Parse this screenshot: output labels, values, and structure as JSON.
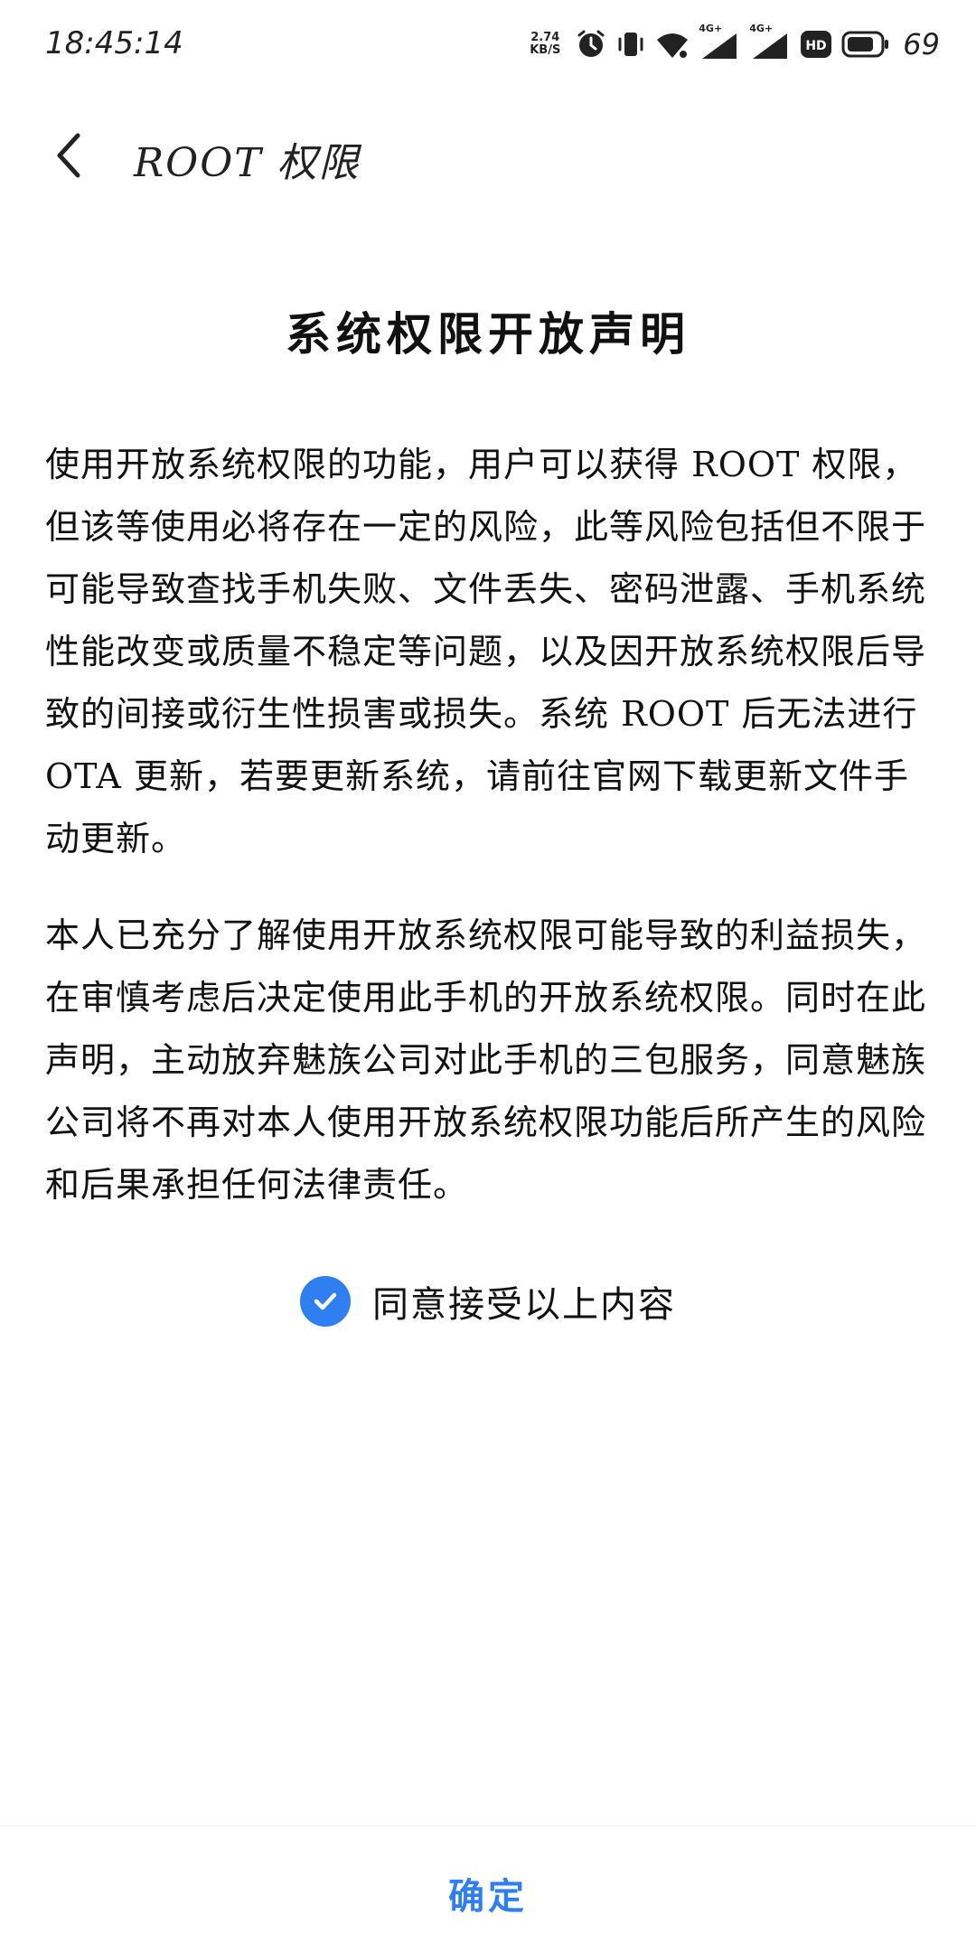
{
  "status_bar": {
    "time": "18:45:14",
    "speed_value": "2.74",
    "speed_unit": "KB/S",
    "net1_tag": "4G+",
    "net2_tag": "4G+",
    "hd_badge": "HD",
    "battery_level": "69",
    "icons": [
      "alarm-icon",
      "vibrate-icon",
      "wifi-icon",
      "signal-icon",
      "signal-icon",
      "hd-icon",
      "battery-icon"
    ]
  },
  "header": {
    "back_icon": "chevron-left-icon",
    "title": "ROOT 权限"
  },
  "declaration": {
    "title": "系统权限开放声明",
    "paragraphs": [
      "使用开放系统权限的功能，用户可以获得 ROOT 权限，但该等使用必将存在一定的风险，此等风险包括但不限于可能导致查找手机失败、文件丢失、密码泄露、手机系统性能改变或质量不稳定等问题，以及因开放系统权限后导致的间接或衍生性损害或损失。系统 ROOT 后无法进行 OTA 更新，若要更新系统，请前往官网下载更新文件手动更新。",
      "本人已充分了解使用开放系统权限可能导致的利益损失，在审慎考虑后决定使用此手机的开放系统权限。同时在此声明，主动放弃魅族公司对此手机的三包服务，同意魅族公司将不再对本人使用开放系统权限功能后所产生的风险和后果承担任何法律责任。"
    ]
  },
  "agreement": {
    "label": "同意接受以上内容",
    "checked": true,
    "check_color": "#2f7ff0"
  },
  "footer": {
    "confirm_label": "确定",
    "confirm_color": "#2f7ff0"
  }
}
